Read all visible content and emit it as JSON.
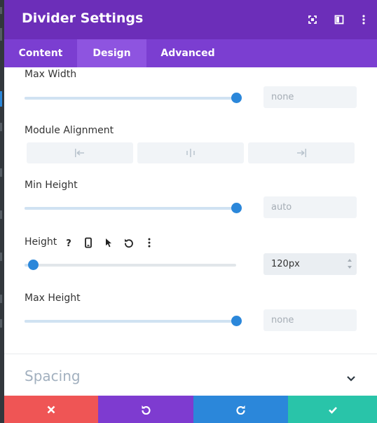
{
  "header": {
    "title": "Divider Settings",
    "icons": [
      "fullscreen-icon",
      "split-view-icon",
      "more-vertical-icon"
    ],
    "bg_color": "#6c2eb9"
  },
  "tabs": [
    {
      "label": "Content",
      "active": false
    },
    {
      "label": "Design",
      "active": true
    },
    {
      "label": "Advanced",
      "active": false
    }
  ],
  "fields": {
    "max_width": {
      "label": "Max Width",
      "value": "none",
      "slider_level": 1.0
    },
    "module_alignment": {
      "label": "Module Alignment",
      "options": [
        "left",
        "center",
        "right"
      ]
    },
    "min_height": {
      "label": "Min Height",
      "value": "auto",
      "slider_level": 1.0
    },
    "height": {
      "label": "Height",
      "value": "120px",
      "slider_level": 0.04,
      "icons": [
        "help-icon",
        "mobile-icon",
        "cursor-icon",
        "reset-icon",
        "more-vertical-icon"
      ]
    },
    "max_height": {
      "label": "Max Height",
      "value": "none",
      "slider_level": 1.0
    }
  },
  "sections": {
    "spacing": {
      "label": "Spacing",
      "collapsed": true
    }
  },
  "footer": {
    "buttons": [
      {
        "action": "cancel",
        "icon": "close-icon",
        "color": "#ef5555"
      },
      {
        "action": "undo",
        "icon": "undo-icon",
        "color": "#7e3bd0"
      },
      {
        "action": "redo",
        "icon": "redo-icon",
        "color": "#2b87da"
      },
      {
        "action": "save",
        "icon": "check-icon",
        "color": "#29c4a9"
      }
    ]
  },
  "colors": {
    "accent": "#2b87da",
    "tabs_bg": "#7b3ed1"
  }
}
